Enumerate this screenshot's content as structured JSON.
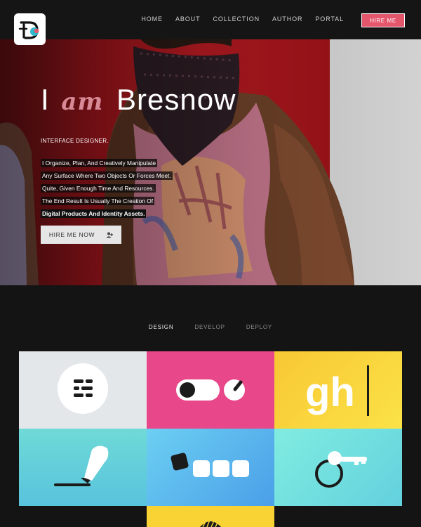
{
  "nav": {
    "items": [
      "HOME",
      "ABOUT",
      "COLLECTION",
      "AUTHOR",
      "PORTAL"
    ],
    "hire_label": "HIRE ME"
  },
  "hero": {
    "title_before": "I",
    "title_accent": "am",
    "title_after": "Bresnow",
    "subtitle": "INTERFACE DESIGNER.",
    "description_lines": [
      "I Organize, Plan, And Creatively Manipulate",
      "Any Surface Where Two Objects Or Forces Meet.",
      "Quite, Given Enough Time And Resources.",
      "The End Result Is Usually The Creation Of"
    ],
    "description_strong": "Digital Products And Identity Assets.",
    "cta_label": "HIRE ME NOW",
    "cta_icon": "add-user-icon"
  },
  "tabs": {
    "items": [
      "DESIGN",
      "DEVELOP",
      "DEPLOY"
    ],
    "active": "DESIGN"
  },
  "tiles": {
    "gh_text": "gh",
    "icons": [
      "menu-lines-icon",
      "toggle-knob-icon",
      "typography-cursor-icon",
      "pen-tool-icon",
      "password-dots-icon",
      "key-icon",
      "partial-circle-icon"
    ]
  },
  "colors": {
    "accent": "#e4566c",
    "tile_grey": "#e5e7e9",
    "tile_pink": "#e8488a",
    "tile_yellow": "#f9d234",
    "tile_teal": "#6fd7d5",
    "tile_blue": "#5cb8ee"
  }
}
